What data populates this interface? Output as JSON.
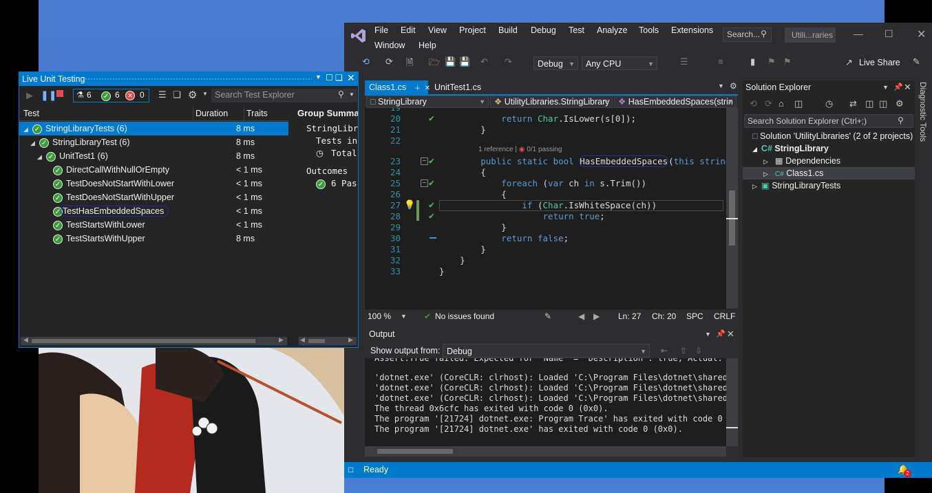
{
  "vs": {
    "menu": [
      "File",
      "Edit",
      "View",
      "Project",
      "Build",
      "Debug",
      "Test",
      "Analyze",
      "Tools",
      "Extensions",
      "Window",
      "Help"
    ],
    "search_label": "Search...",
    "solution_short": "Utili...raries",
    "config": "Debug",
    "platform": "Any CPU",
    "live_share": "Live Share",
    "side_panel_label": "Diagnostic Tools"
  },
  "editor": {
    "tabs": [
      "Class1.cs",
      "UnitTest1.cs"
    ],
    "nav": [
      "StringLibrary",
      "UtilityLibraries.StringLibrary",
      "HasEmbeddedSpaces(strin"
    ],
    "codelens": "1 reference | ",
    "codelens_tests": "0/1 passing",
    "lines": [
      {
        "n": "19",
        "code": ""
      },
      {
        "n": "20",
        "code": "            return Char.IsLower(s[0]);"
      },
      {
        "n": "21",
        "code": "        }"
      },
      {
        "n": "22",
        "code": ""
      },
      {
        "n": "23",
        "code": "        public static bool HasEmbeddedSpaces(this string s)"
      },
      {
        "n": "24",
        "code": "        {"
      },
      {
        "n": "25",
        "code": "            foreach (var ch in s.Trim())"
      },
      {
        "n": "26",
        "code": "            {"
      },
      {
        "n": "27",
        "code": "                if (Char.IsWhiteSpace(ch))"
      },
      {
        "n": "28",
        "code": "                    return true;"
      },
      {
        "n": "29",
        "code": "            }"
      },
      {
        "n": "30",
        "code": "            return false;"
      },
      {
        "n": "31",
        "code": "        }"
      },
      {
        "n": "32",
        "code": "    }"
      },
      {
        "n": "33",
        "code": "}"
      }
    ],
    "zoom": "100 %",
    "issues": "No issues found",
    "ln": "Ln: 27",
    "ch": "Ch: 20",
    "spc": "SPC",
    "crlf": "CRLF"
  },
  "output": {
    "title": "Output",
    "show_from_label": "Show output from:",
    "source": "Debug",
    "lines": [
      "'dotnet.exe' (CoreCLR: clrhost): Loaded 'C:\\Program Files\\dotnet\\shared\\M",
      "'dotnet.exe' (CoreCLR: clrhost): Loaded 'C:\\Program Files\\dotnet\\shared\\M",
      "'dotnet.exe' (CoreCLR: clrhost): Loaded 'C:\\Program Files\\dotnet\\shared\\M",
      "The thread 0x6cfc has exited with code 0 (0x0).",
      "The program '[21724] dotnet.exe: Program Trace' has exited with code 0 (0",
      "The program '[21724] dotnet.exe' has exited with code 0 (0x0)."
    ]
  },
  "solution_explorer": {
    "title": "Solution Explorer",
    "search_placeholder": "Search Solution Explorer (Ctrl+;)",
    "solution": "Solution 'UtilityLibraries' (2 of 2 projects)",
    "items": [
      "StringLibrary",
      "Dependencies",
      "Class1.cs",
      "StringLibraryTests"
    ]
  },
  "status": {
    "text": "Ready",
    "notifications": "2"
  },
  "lut": {
    "title": "Live Unit Testing",
    "counts": {
      "all": "6",
      "passed": "6",
      "failed": "0"
    },
    "search_placeholder": "Search Test Explorer",
    "columns": [
      "Test",
      "Duration",
      "Traits"
    ],
    "rows": [
      {
        "name": "StringLibraryTests (6)",
        "dur": "8 ms"
      },
      {
        "name": "StringLibraryTest (6)",
        "dur": "8 ms"
      },
      {
        "name": "UnitTest1 (6)",
        "dur": "8 ms"
      },
      {
        "name": "DirectCallWithNullOrEmpty",
        "dur": "< 1 ms"
      },
      {
        "name": "TestDoesNotStartWithLower",
        "dur": "< 1 ms"
      },
      {
        "name": "TestDoesNotStartWithUpper",
        "dur": "< 1 ms"
      },
      {
        "name": "TestHasEmbeddedSpaces",
        "dur": "< 1 ms"
      },
      {
        "name": "TestStartsWithLower",
        "dur": "< 1 ms"
      },
      {
        "name": "TestStartsWithUpper",
        "dur": "8 ms"
      }
    ],
    "summary_title": "Group Summa",
    "summary_lines": [
      "StringLibra",
      "Tests in",
      "Total"
    ],
    "outcomes_label": "Outcomes",
    "outcomes_value": "6 Pas"
  }
}
